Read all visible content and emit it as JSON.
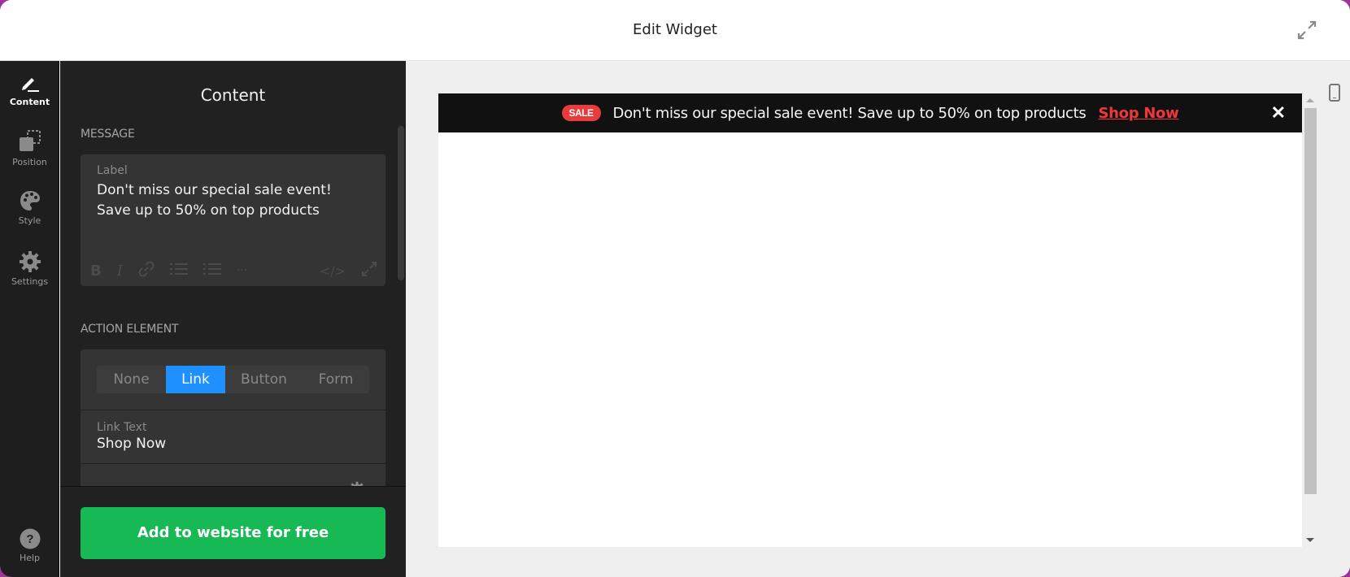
{
  "header": {
    "title": "Edit Widget",
    "expand_icon": "expand-arrows-icon"
  },
  "rail": {
    "items": [
      {
        "label": "Content",
        "icon": "pencil-icon",
        "active": true
      },
      {
        "label": "Position",
        "icon": "position-icon",
        "active": false
      },
      {
        "label": "Style",
        "icon": "palette-icon",
        "active": false
      },
      {
        "label": "Settings",
        "icon": "gear-icon",
        "active": false
      }
    ],
    "help": {
      "label": "Help",
      "icon": "question-icon"
    }
  },
  "panel": {
    "title": "Content",
    "message": {
      "section_label": "MESSAGE",
      "field_label": "Label",
      "value": "Don't miss our special sale event! Save up to 50% on top products",
      "toolbar": {
        "bold": "B",
        "italic": "I",
        "link": "link-icon",
        "bullet_list": "bullet-list-icon",
        "numbered_list": "numbered-list-icon",
        "more": "···",
        "code": "</>",
        "fullscreen": "fullscreen-icon"
      }
    },
    "action_element": {
      "section_label": "ACTION ELEMENT",
      "options": [
        "None",
        "Link",
        "Button",
        "Form"
      ],
      "selected": "Link",
      "link_text_label": "Link Text",
      "link_text_value": "Shop Now"
    },
    "cta_label": "Add to website for free"
  },
  "preview": {
    "badge": "SALE",
    "message": "Don't miss our special sale event! Save up to 50% on top products",
    "link": "Shop Now",
    "close": "✕",
    "colors": {
      "bar_bg": "#111111",
      "badge_bg": "#e93b3b",
      "link": "#f0383a"
    }
  },
  "colors": {
    "accent": "#1e90ff",
    "cta": "#17b955"
  }
}
